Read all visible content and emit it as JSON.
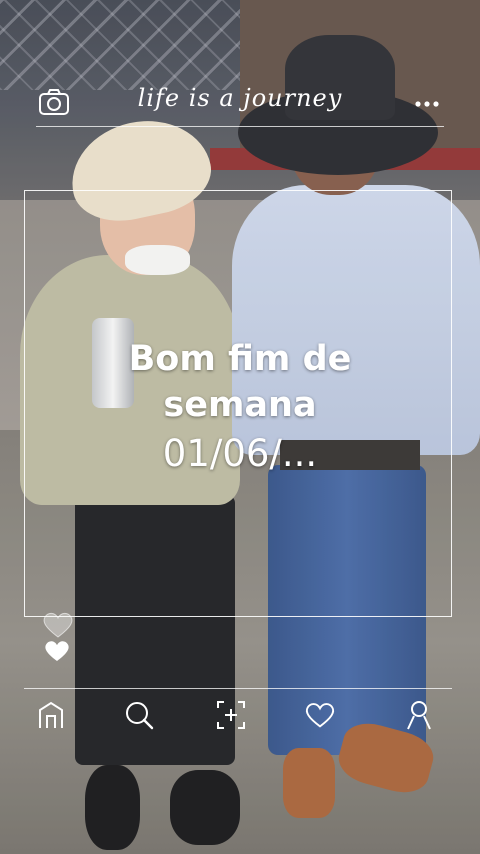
{
  "header": {
    "title": "life is a journey",
    "left_icon": "camera-icon",
    "right_icon": "more-icon"
  },
  "caption": {
    "line1": "Bom fim de",
    "line2": "semana",
    "line3": "01/06/..."
  },
  "reactions": {
    "icons": [
      "heart-outline-icon",
      "heart-filled-icon"
    ]
  },
  "bottom_nav": {
    "items": [
      "home-icon",
      "search-icon",
      "add-post-icon",
      "heart-icon",
      "profile-icon"
    ]
  },
  "colors": {
    "overlay": "#ffffff"
  }
}
